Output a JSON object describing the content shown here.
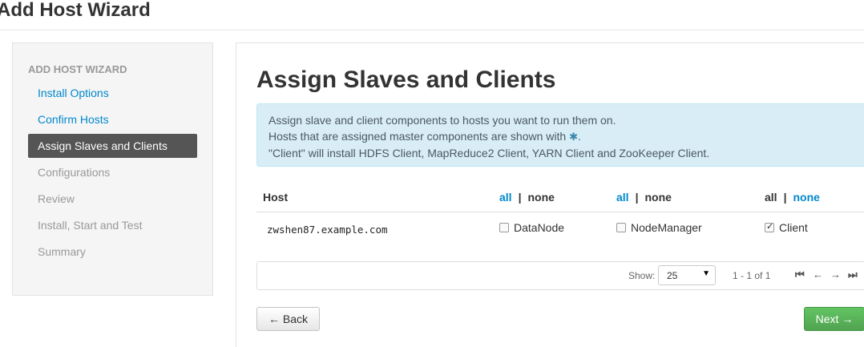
{
  "page": {
    "title": "Add Host Wizard"
  },
  "sidebar": {
    "header": "ADD HOST WIZARD",
    "items": [
      {
        "label": "Install Options",
        "state": "done"
      },
      {
        "label": "Confirm Hosts",
        "state": "done"
      },
      {
        "label": "Assign Slaves and Clients",
        "state": "active"
      },
      {
        "label": "Configurations",
        "state": "pending"
      },
      {
        "label": "Review",
        "state": "pending"
      },
      {
        "label": "Install, Start and Test",
        "state": "pending"
      },
      {
        "label": "Summary",
        "state": "pending"
      }
    ]
  },
  "main": {
    "title": "Assign Slaves and Clients",
    "info": {
      "line1": "Assign slave and client components to hosts you want to run them on.",
      "line2_prefix": "Hosts that are assigned master components are shown with",
      "master_icon": "✱",
      "line2_suffix": ".",
      "line3": "\"Client\" will install HDFS Client, MapReduce2 Client, YARN Client and ZooKeeper Client."
    },
    "table": {
      "host_header": "Host",
      "columns": [
        {
          "all": "all",
          "sep": "|",
          "none": "none",
          "component": "DataNode",
          "checked": false
        },
        {
          "all": "all",
          "sep": "|",
          "none": "none",
          "component": "NodeManager",
          "checked": false
        },
        {
          "all": "all",
          "sep": "|",
          "none": "none",
          "component": "Client",
          "checked": true
        }
      ],
      "rows": [
        {
          "host": "zwshen87.example.com"
        }
      ]
    },
    "pager": {
      "show_label": "Show:",
      "page_size": "25",
      "caret": "▼",
      "range": "1 - 1 of 1",
      "first_icon": "⏮",
      "prev_icon": "←",
      "next_icon": "→",
      "last_icon": "⏭"
    },
    "buttons": {
      "back": "← Back",
      "next": "Next →"
    }
  },
  "colors": {
    "link": "#0088cc",
    "active_nav": "#555555",
    "info_bg": "#d9edf7",
    "next_button": "#51a351"
  }
}
